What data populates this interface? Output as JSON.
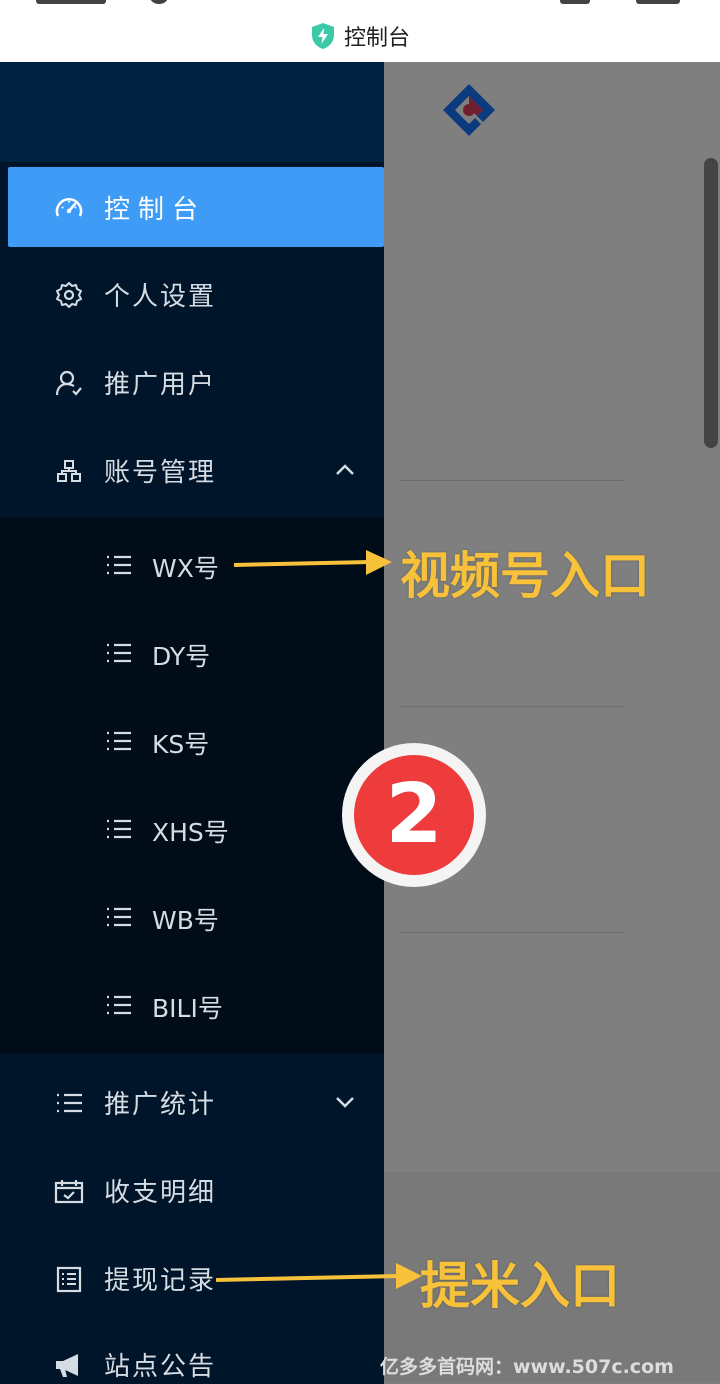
{
  "browser": {
    "title": "控制台"
  },
  "sidebar": {
    "items": [
      {
        "label": "控制台",
        "icon": "dashboard-icon",
        "active": true
      },
      {
        "label": "个人设置",
        "icon": "gear-icon"
      },
      {
        "label": "推广用户",
        "icon": "user-icon"
      },
      {
        "label": "账号管理",
        "icon": "cluster-icon",
        "expanded": true
      },
      {
        "label": "推广统计",
        "icon": "list-icon"
      },
      {
        "label": "收支明细",
        "icon": "calendar-check-icon"
      },
      {
        "label": "提现记录",
        "icon": "document-icon"
      },
      {
        "label": "站点公告",
        "icon": "megaphone-icon"
      }
    ],
    "account_submenu": [
      {
        "label": "WX号"
      },
      {
        "label": "DY号"
      },
      {
        "label": "KS号"
      },
      {
        "label": "XHS号"
      },
      {
        "label": "WB号"
      },
      {
        "label": "BILI号"
      }
    ]
  },
  "annotations": {
    "video_entry": "视频号入口",
    "withdraw_entry": "提米入口",
    "step_number": "2"
  },
  "watermark": "亿多多首码网：www.507c.com",
  "colors": {
    "sidebar_bg": "#001529",
    "submenu_bg": "#000c17",
    "active_bg": "#3e9cf7",
    "annotation": "#f7c23a",
    "badge": "#ee3b3b"
  }
}
